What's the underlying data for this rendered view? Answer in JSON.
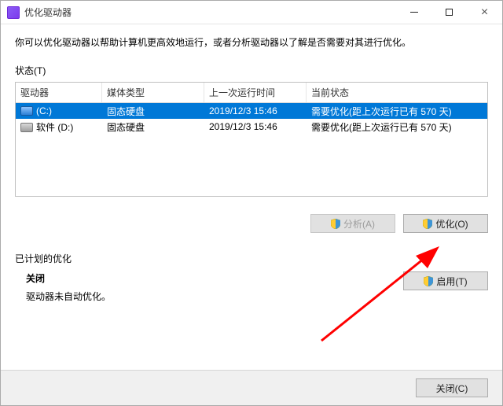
{
  "window": {
    "title": "优化驱动器"
  },
  "description": "你可以优化驱动器以帮助计算机更高效地运行，或者分析驱动器以了解是否需要对其进行优化。",
  "status_label": "状态(T)",
  "table": {
    "headers": {
      "drive": "驱动器",
      "media": "媒体类型",
      "last_run": "上一次运行时间",
      "current": "当前状态"
    },
    "rows": [
      {
        "drive": "(C:)",
        "media": "固态硬盘",
        "last_run": "2019/12/3 15:46",
        "current": "需要优化(距上次运行已有 570 天)"
      },
      {
        "drive": "软件 (D:)",
        "media": "固态硬盘",
        "last_run": "2019/12/3 15:46",
        "current": "需要优化(距上次运行已有 570 天)"
      }
    ]
  },
  "buttons": {
    "analyze": "分析(A)",
    "optimize": "优化(O)",
    "enable": "启用(T)",
    "close": "关闭(C)"
  },
  "schedule": {
    "label": "已计划的优化",
    "off": "关闭",
    "message": "驱动器未自动优化。"
  }
}
